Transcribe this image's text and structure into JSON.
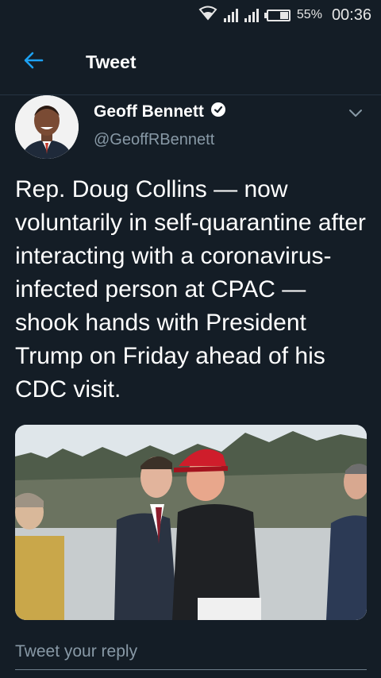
{
  "status_bar": {
    "battery": "55%",
    "time": "00:36",
    "icons": [
      "wifi-icon",
      "signal-icon",
      "signal-icon",
      "battery-icon"
    ]
  },
  "header": {
    "title": "Tweet",
    "back_icon": "arrow-left-icon",
    "accent_color": "#1da1f2"
  },
  "tweet": {
    "author_name": "Geoff Bennett",
    "verified_icon": "verified-badge-icon",
    "handle": "@GeoffRBennett",
    "menu_icon": "chevron-down-icon",
    "text": "Rep. Doug Collins — now voluntarily in self-quarantine after interacting with a coronavirus-infected person at CPAC — shook hands with President Trump on Friday ahead of his CDC visit."
  },
  "reply": {
    "placeholder": "Tweet your reply"
  },
  "colors": {
    "background": "#141d26",
    "secondary_text": "#8899a6",
    "primary_text": "#ffffff"
  }
}
